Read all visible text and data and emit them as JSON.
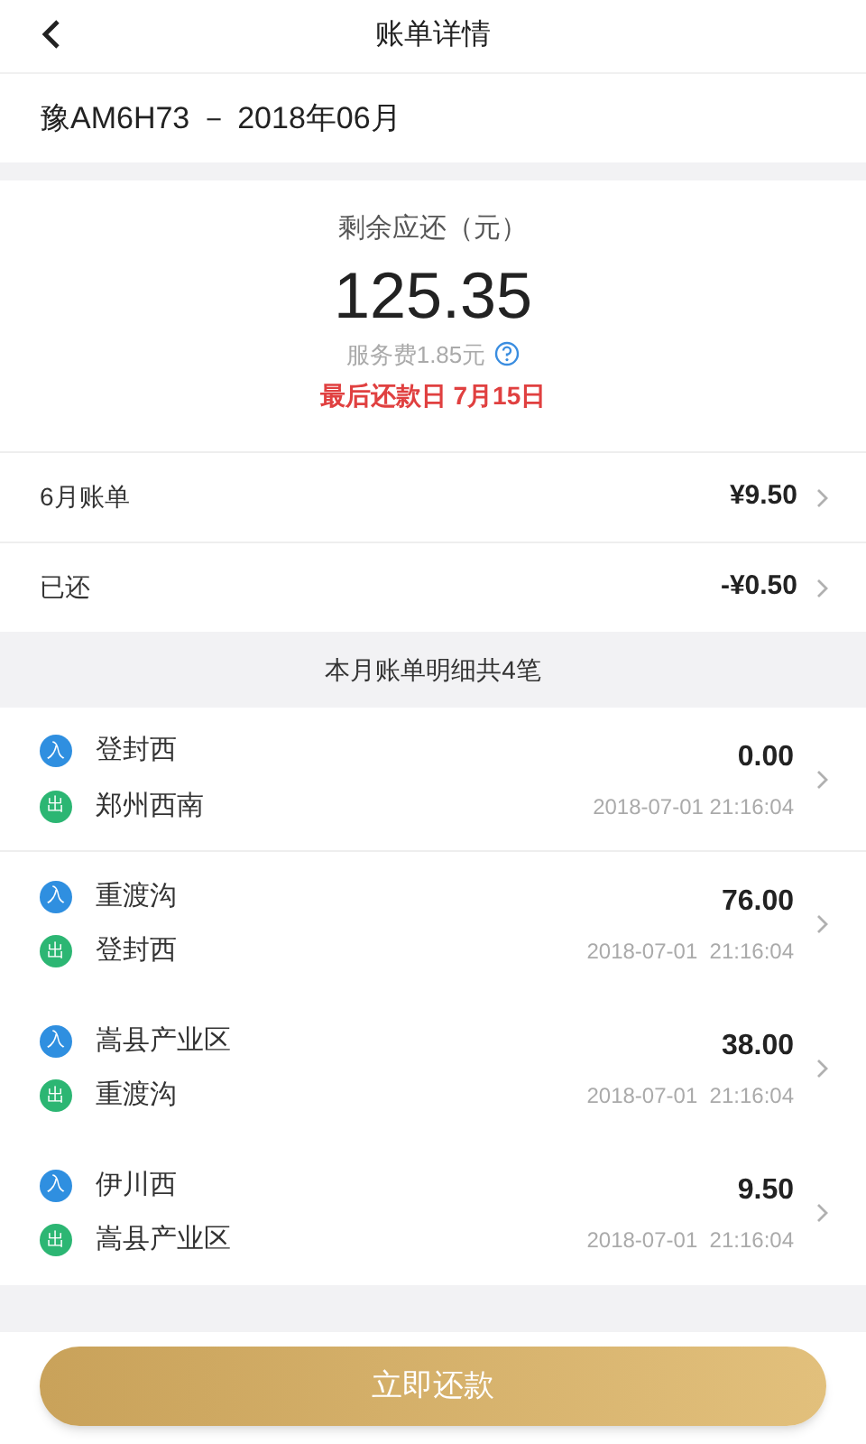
{
  "header": {
    "title": "账单详情"
  },
  "plate_period": "豫AM6H73 － 2018年06月",
  "summary": {
    "label": "剩余应还（元）",
    "amount": "125.35",
    "fee": "服务费1.85元",
    "deadline": "最后还款日 7月15日"
  },
  "bill_rows": [
    {
      "label": "6月账单",
      "value": "¥9.50"
    },
    {
      "label": "已还",
      "value": "-¥0.50"
    }
  ],
  "section_title": "本月账单明细共4笔",
  "trips": [
    {
      "stops": [
        {
          "kind": "entry",
          "badge": "入",
          "name": "登封西"
        },
        {
          "kind": "exit",
          "badge": "出",
          "name": "郑州西南"
        }
      ],
      "amount": "0.00",
      "time": "2018-07-01 21:16:04"
    },
    {
      "stops": [
        {
          "kind": "entry",
          "badge": "入",
          "name": "重渡沟"
        },
        {
          "kind": "exit",
          "badge": "出",
          "name": "登封西"
        }
      ],
      "amount": "76.00",
      "time": "2018-07-01  21:16:04"
    },
    {
      "stops": [
        {
          "kind": "entry",
          "badge": "入",
          "name": "嵩县产业区"
        },
        {
          "kind": "exit",
          "badge": "出",
          "name": "重渡沟"
        }
      ],
      "amount": "38.00",
      "time": "2018-07-01  21:16:04"
    },
    {
      "stops": [
        {
          "kind": "entry",
          "badge": "入",
          "name": "伊川西"
        },
        {
          "kind": "exit",
          "badge": "出",
          "name": "嵩县产业区"
        }
      ],
      "amount": "9.50",
      "time": "2018-07-01  21:16:04"
    }
  ],
  "pay_button": "立即还款"
}
